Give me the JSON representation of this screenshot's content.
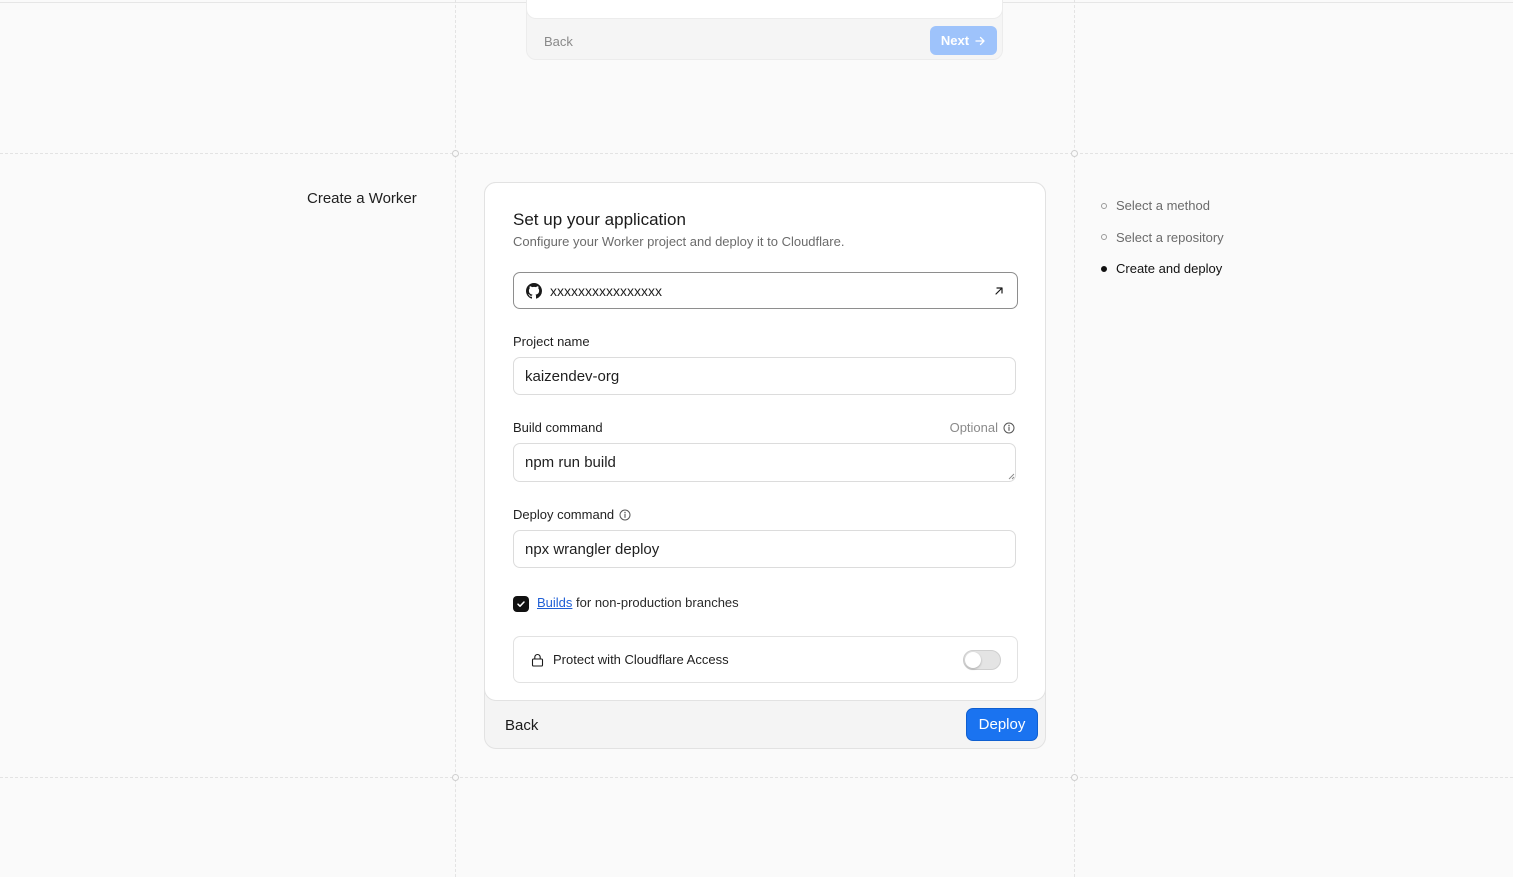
{
  "previous_step": {
    "back_label": "Back",
    "next_label": "Next"
  },
  "page": {
    "heading": "Create a Worker"
  },
  "form": {
    "title": "Set up your application",
    "subtitle": "Configure your Worker project and deploy it to Cloudflare.",
    "repository": {
      "name": "xxxxxxxxxxxxxxxx",
      "icon": "github-icon",
      "action_icon": "external-link-arrow-icon"
    },
    "project_name": {
      "label": "Project name",
      "value": "kaizendev-org"
    },
    "build_command": {
      "label": "Build command",
      "optional_label": "Optional",
      "value": "npm run build"
    },
    "deploy_command": {
      "label": "Deploy command",
      "value": "npx wrangler deploy"
    },
    "builds_checkbox": {
      "checked": true,
      "link_label": "Builds",
      "rest_label": "for non-production branches"
    },
    "access": {
      "label": "Protect with Cloudflare Access",
      "enabled": false
    },
    "footer": {
      "back_label": "Back",
      "deploy_label": "Deploy"
    }
  },
  "stepper": {
    "steps": [
      {
        "label": "Select a method",
        "active": false
      },
      {
        "label": "Select a repository",
        "active": false
      },
      {
        "label": "Create and deploy",
        "active": true
      }
    ]
  },
  "colors": {
    "accent": "#1a73f0",
    "link": "#1f5fd6",
    "disabled_accent": "#9ec3fb"
  }
}
